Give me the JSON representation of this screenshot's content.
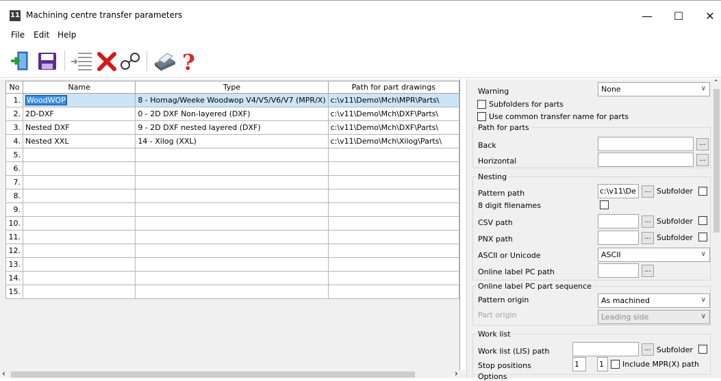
{
  "window": {
    "title": "Machining centre transfer parameters",
    "app_icon_text": "11"
  },
  "menu": [
    "File",
    "Edit",
    "Help"
  ],
  "grid": {
    "headers": [
      "No",
      "Name",
      "Type",
      "Path for part drawings"
    ],
    "rows": [
      {
        "no": "1.",
        "name": "WoodWOP",
        "type": "8 - Homag/Weeke Woodwop V4/V5/V6/V7 (MPR/X)",
        "path": "c:\\v11\\Demo\\Mch\\MPR\\Parts\\"
      },
      {
        "no": "2.",
        "name": "2D-DXF",
        "type": "0 - 2D DXF Non-layered (DXF)",
        "path": "c:\\v11\\Demo\\Mch\\DXF\\Parts\\"
      },
      {
        "no": "3.",
        "name": "Nested DXF",
        "type": "9 - 2D DXF nested layered (DXF)",
        "path": "c:\\v11\\Demo\\Mch\\DXF\\Parts\\"
      },
      {
        "no": "4.",
        "name": "Nested XXL",
        "type": "14 - Xilog (XXL)",
        "path": "c:\\v11\\Demo\\Mch\\Xilog\\Parts\\"
      },
      {
        "no": "5.",
        "name": "",
        "type": "",
        "path": ""
      },
      {
        "no": "6.",
        "name": "",
        "type": "",
        "path": ""
      },
      {
        "no": "7.",
        "name": "",
        "type": "",
        "path": ""
      },
      {
        "no": "8.",
        "name": "",
        "type": "",
        "path": ""
      },
      {
        "no": "9.",
        "name": "",
        "type": "",
        "path": ""
      },
      {
        "no": "10.",
        "name": "",
        "type": "",
        "path": ""
      },
      {
        "no": "11.",
        "name": "",
        "type": "",
        "path": ""
      },
      {
        "no": "12.",
        "name": "",
        "type": "",
        "path": ""
      },
      {
        "no": "13.",
        "name": "",
        "type": "",
        "path": ""
      },
      {
        "no": "14.",
        "name": "",
        "type": "",
        "path": ""
      },
      {
        "no": "15.",
        "name": "",
        "type": "",
        "path": ""
      }
    ]
  },
  "panel": {
    "warning_label": "Warning",
    "warning_value": "None",
    "subfolders_label": "Subfolders for parts",
    "common_name_label": "Use common transfer name for parts",
    "path_group_title": "Path for parts",
    "back_label": "Back",
    "horizontal_label": "Horizontal",
    "nesting_title": "Nesting",
    "pattern_path_label": "Pattern path",
    "pattern_path_value": "c:\\v11\\De",
    "subfolder_label": "Subfolder",
    "digit_label": "8 digit filenames",
    "csv_label": "CSV path",
    "pnx_label": "PNX path",
    "ascii_label": "ASCII or Unicode",
    "ascii_value": "ASCII",
    "online_label": "Online label PC path",
    "sequence_title": "Online label PC part sequence",
    "pattern_origin_label": "Pattern origin",
    "pattern_origin_value": "As machined",
    "part_origin_label": "Part origin",
    "part_origin_value": "Leading side",
    "worklist_title": "Work list",
    "worklist_label": "Work list (LIS) path",
    "stop_label": "Stop positions",
    "stop_a": "1",
    "stop_b": "1",
    "include_label": "Include MPR(X) path",
    "options_title": "Options",
    "browse_glyph": "..."
  }
}
